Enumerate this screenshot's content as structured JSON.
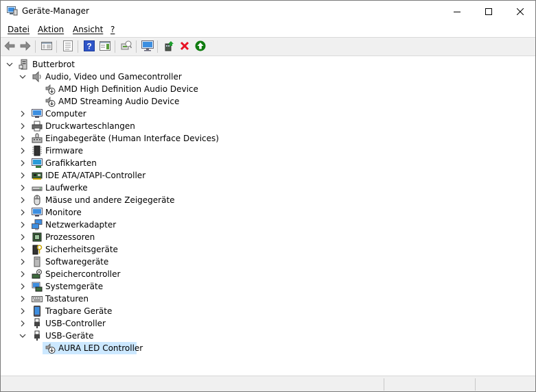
{
  "window": {
    "title": "Geräte-Manager"
  },
  "menu": {
    "items": [
      "Datei",
      "Aktion",
      "Ansicht",
      "?"
    ]
  },
  "toolbar": {
    "buttons": [
      "back-icon",
      "forward-icon",
      "show-hide-tree-icon",
      "properties-icon",
      "help-icon",
      "action-pane-icon",
      "scan-hardware-icon",
      "update-driver-icon",
      "enable-device-icon",
      "uninstall-icon",
      "install-icon"
    ]
  },
  "tree": {
    "root": "Butterbrot",
    "categories": [
      {
        "label": "Audio, Video und Gamecontroller",
        "expanded": true,
        "children": [
          "AMD High Definition Audio Device",
          "AMD Streaming Audio Device"
        ]
      },
      {
        "label": "Computer"
      },
      {
        "label": "Druckwarteschlangen"
      },
      {
        "label": "Eingabegeräte (Human Interface Devices)"
      },
      {
        "label": "Firmware"
      },
      {
        "label": "Grafikkarten"
      },
      {
        "label": "IDE ATA/ATAPI-Controller"
      },
      {
        "label": "Laufwerke"
      },
      {
        "label": "Mäuse und andere Zeigegeräte"
      },
      {
        "label": "Monitore"
      },
      {
        "label": "Netzwerkadapter"
      },
      {
        "label": "Prozessoren"
      },
      {
        "label": "Sicherheitsgeräte"
      },
      {
        "label": "Softwaregeräte"
      },
      {
        "label": "Speichercontroller"
      },
      {
        "label": "Systemgeräte"
      },
      {
        "label": "Tastaturen"
      },
      {
        "label": "Tragbare Geräte"
      },
      {
        "label": "USB-Controller"
      },
      {
        "label": "USB-Geräte",
        "expanded": true,
        "children": [
          "AURA LED Controller"
        ]
      }
    ],
    "selected": "AURA LED Controller"
  },
  "colors": {
    "selection": "#cce8ff",
    "uninstall": "#e81123",
    "install": "#107c10",
    "help": "#2f55c8"
  }
}
